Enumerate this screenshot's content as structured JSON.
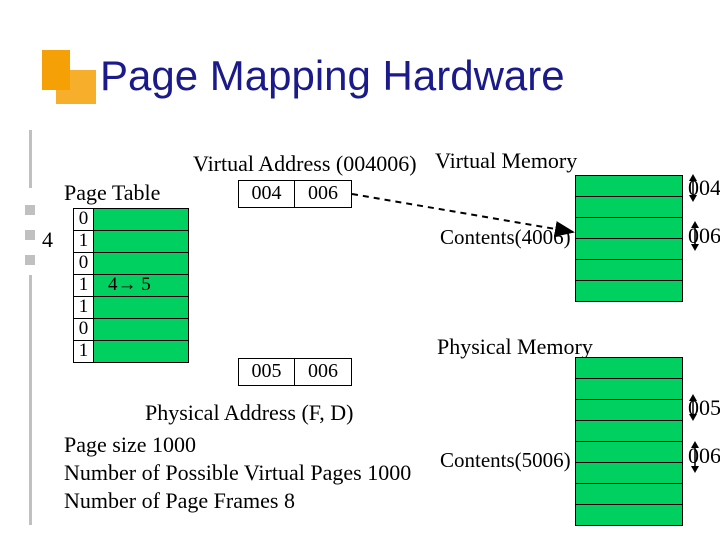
{
  "title": "Page Mapping Hardware",
  "labels": {
    "virtual_address": "Virtual Address (004006)",
    "virtual_memory": "Virtual Memory",
    "page_table": "Page Table",
    "physical_memory": "Physical Memory",
    "physical_address": "Physical Address (F, D)"
  },
  "page_table": {
    "highlighted_index": "4",
    "rows": [
      {
        "bit": "0",
        "note": ""
      },
      {
        "bit": "1",
        "note": ""
      },
      {
        "bit": "0",
        "note": ""
      },
      {
        "bit": "1",
        "note": " 4→ 5"
      },
      {
        "bit": "1",
        "note": ""
      },
      {
        "bit": "0",
        "note": ""
      },
      {
        "bit": "1",
        "note": ""
      }
    ]
  },
  "addresses": {
    "virtual": {
      "page": "004",
      "offset": "006"
    },
    "physical": {
      "frame": "005",
      "offset": "006"
    }
  },
  "virtual_memory": {
    "label_page": "004",
    "label_offset": "006",
    "contents": "Contents(4006)"
  },
  "physical_memory": {
    "label_frame": "005",
    "label_offset": "006",
    "contents": "Contents(5006)"
  },
  "footer": {
    "line1": "Page size 1000",
    "line2": "Number of Possible Virtual Pages 1000",
    "line3": "Number of Page Frames 8"
  }
}
